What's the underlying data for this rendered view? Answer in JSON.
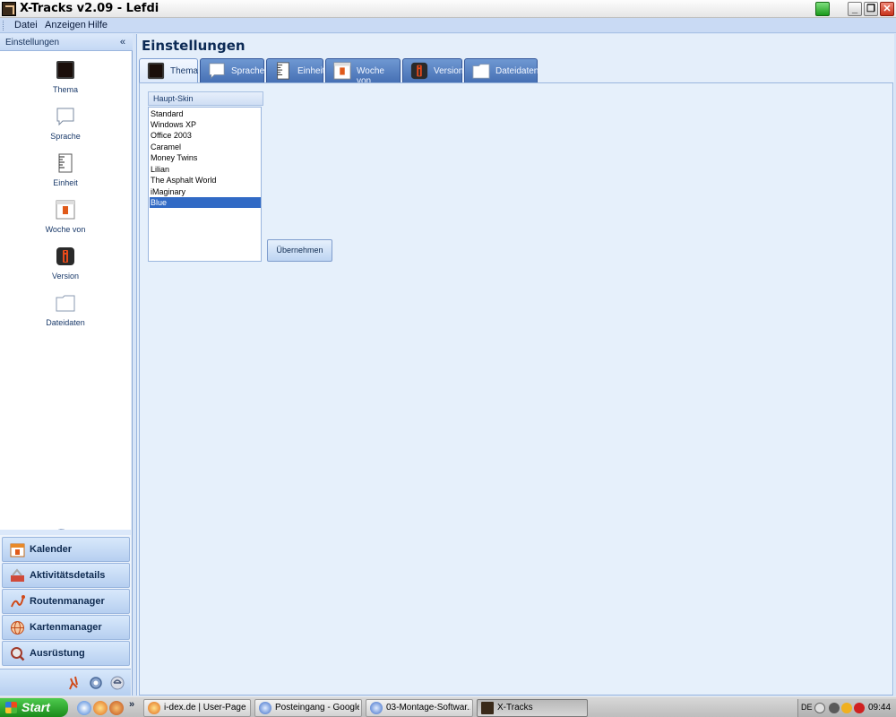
{
  "window": {
    "title": "X-Tracks v2.09 - Lefdi",
    "controls": {
      "minimize": "_",
      "maximize": "❐",
      "close": "✕"
    }
  },
  "menubar": {
    "items": [
      {
        "label": "Datei"
      },
      {
        "label": "Anzeigen"
      },
      {
        "label": "Hilfe"
      }
    ]
  },
  "navpane": {
    "header": "Einstellungen",
    "collapse_glyph": "«",
    "items": [
      {
        "label": "Thema",
        "icon": "theme-icon"
      },
      {
        "label": "Sprache",
        "icon": "speech-bubble-icon"
      },
      {
        "label": "Einheit",
        "icon": "ruler-icon"
      },
      {
        "label": "Woche von",
        "icon": "calendar-page-icon"
      },
      {
        "label": "Version",
        "icon": "info-icon"
      },
      {
        "label": "Dateidaten",
        "icon": "folder-icon"
      }
    ],
    "sections": [
      {
        "label": "Kalender",
        "icon": "calendar-icon"
      },
      {
        "label": "Aktivitätsdetails",
        "icon": "activity-icon"
      },
      {
        "label": "Routenmanager",
        "icon": "route-icon"
      },
      {
        "label": "Kartenmanager",
        "icon": "globe-icon"
      },
      {
        "label": "Ausrüstung",
        "icon": "equipment-icon"
      }
    ]
  },
  "main": {
    "title": "Einstellungen",
    "tabs": [
      {
        "label": "Thema",
        "active": true
      },
      {
        "label": "Sprache"
      },
      {
        "label": "Einheit"
      },
      {
        "label": "Woche von"
      },
      {
        "label": "Version"
      },
      {
        "label": "Dateidaten"
      }
    ],
    "skin_group": {
      "header": "Haupt-Skin",
      "options": [
        "Standard",
        "Windows XP",
        "Office 2003",
        "Caramel",
        "Money Twins",
        "Lilian",
        "The Asphalt World",
        "iMaginary",
        "Blue"
      ],
      "selected": "Blue"
    },
    "apply_label": "Übernehmen"
  },
  "taskbar": {
    "start_label": "Start",
    "quicklaunch_more": "»",
    "tasks": [
      {
        "label": "i-dex.de | User-Page ..."
      },
      {
        "label": "Posteingang - Google..."
      },
      {
        "label": "03-Montage-Softwar..."
      },
      {
        "label": "X-Tracks",
        "active": true
      }
    ],
    "tray": {
      "language": "DE",
      "clock": "09:44"
    }
  },
  "colors": {
    "accent": "#316ac5",
    "tab_inactive": "#5a82c4",
    "panel": "#e6f0fb"
  }
}
